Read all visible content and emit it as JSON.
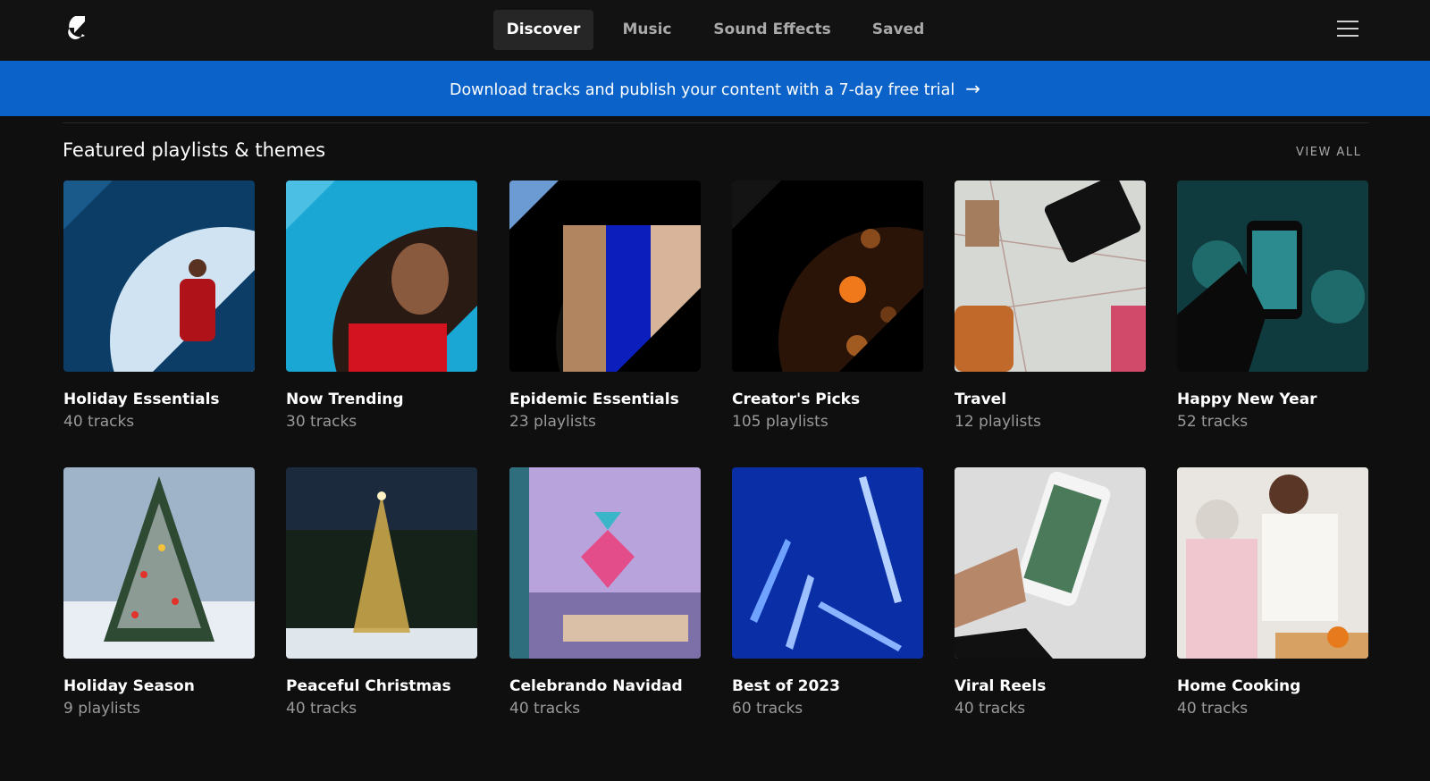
{
  "header": {
    "logo_icon": "brand-logo-icon",
    "tabs": [
      {
        "label": "Discover",
        "active": true
      },
      {
        "label": "Music",
        "active": false
      },
      {
        "label": "Sound Effects",
        "active": false
      },
      {
        "label": "Saved",
        "active": false
      }
    ],
    "menu_icon": "hamburger-menu-icon"
  },
  "banner": {
    "text": "Download tracks and publish your content with a 7-day free trial",
    "arrow": "→",
    "color": "#0b63c9"
  },
  "section": {
    "title": "Featured playlists & themes",
    "view_all": "VIEW ALL"
  },
  "playlists": [
    {
      "title": "Holiday Essentials",
      "subtitle": "40 tracks"
    },
    {
      "title": "Now Trending",
      "subtitle": "30 tracks"
    },
    {
      "title": "Epidemic Essentials",
      "subtitle": "23 playlists"
    },
    {
      "title": "Creator's Picks",
      "subtitle": "105 playlists"
    },
    {
      "title": "Travel",
      "subtitle": "12 playlists"
    },
    {
      "title": "Happy New Year",
      "subtitle": "52 tracks"
    },
    {
      "title": "Holiday Season",
      "subtitle": "9 playlists"
    },
    {
      "title": "Peaceful Christmas",
      "subtitle": "40 tracks"
    },
    {
      "title": "Celebrando Navidad",
      "subtitle": "40 tracks"
    },
    {
      "title": "Best of 2023",
      "subtitle": "60 tracks"
    },
    {
      "title": "Viral Reels",
      "subtitle": "40 tracks"
    },
    {
      "title": "Home Cooking",
      "subtitle": "40 tracks"
    }
  ]
}
